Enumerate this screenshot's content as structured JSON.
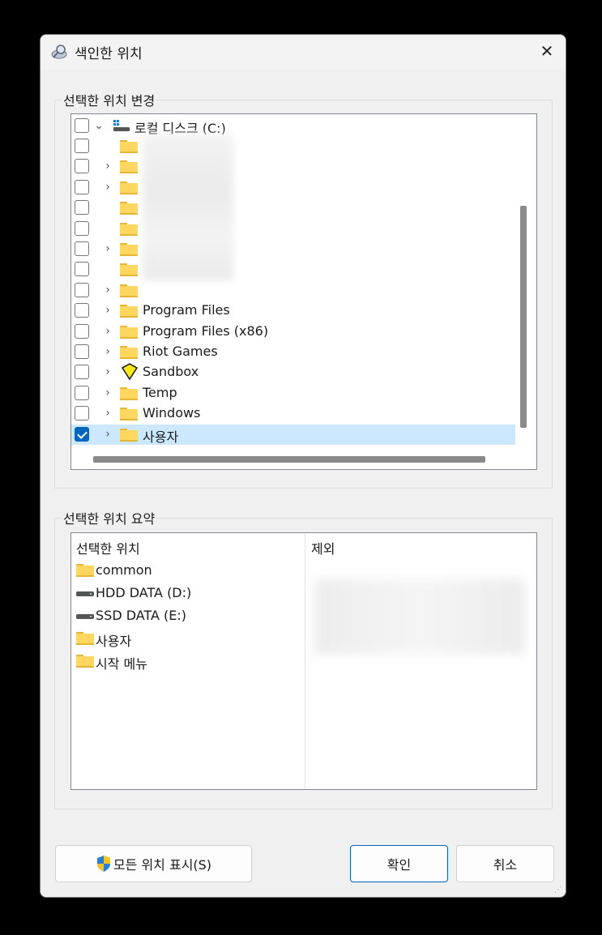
{
  "window": {
    "title": "색인한 위치",
    "close_glyph": "✕",
    "title_icon": "indexing-icon"
  },
  "change_group": {
    "legend": "선택한 위치 변경",
    "root": {
      "label": "로컬 디스크 (C:)",
      "checked": false,
      "expanded": true,
      "icon": "drive-icon"
    },
    "items": [
      {
        "label": "",
        "checked": false,
        "expandable": false,
        "blurred": true
      },
      {
        "label": "",
        "checked": false,
        "expandable": true,
        "blurred": true
      },
      {
        "label": "",
        "checked": false,
        "expandable": true,
        "blurred": true
      },
      {
        "label": "",
        "checked": false,
        "expandable": false,
        "blurred": true
      },
      {
        "label": "",
        "checked": false,
        "expandable": false,
        "blurred": true
      },
      {
        "label": "",
        "checked": false,
        "expandable": true,
        "blurred": true
      },
      {
        "label": "",
        "checked": false,
        "expandable": false,
        "blurred": true
      },
      {
        "label": "",
        "checked": false,
        "expandable": true,
        "blurred": true
      },
      {
        "label": "Program Files",
        "checked": false,
        "expandable": true
      },
      {
        "label": "Program Files (x86)",
        "checked": false,
        "expandable": true
      },
      {
        "label": "Riot Games",
        "checked": false,
        "expandable": true
      },
      {
        "label": "Sandbox",
        "checked": false,
        "expandable": true,
        "icon": "sandbox-icon"
      },
      {
        "label": "Temp",
        "checked": false,
        "expandable": true
      },
      {
        "label": "Windows",
        "checked": false,
        "expandable": true
      },
      {
        "label": "사용자",
        "checked": true,
        "expandable": true,
        "selected": true
      }
    ]
  },
  "summary_group": {
    "legend": "선택한 위치 요약",
    "col_included": "선택한 위치",
    "col_excluded": "제외",
    "included": [
      {
        "label": "common",
        "icon": "folder-icon"
      },
      {
        "label": "HDD DATA (D:)",
        "icon": "hdd-icon"
      },
      {
        "label": "SSD DATA (E:)",
        "icon": "hdd-icon"
      },
      {
        "label": "사용자",
        "icon": "folder-icon"
      },
      {
        "label": "시작 메뉴",
        "icon": "folder-icon"
      }
    ]
  },
  "buttons": {
    "show_all": "모든 위치 표시(S)",
    "ok": "확인",
    "cancel": "취소"
  },
  "colors": {
    "accent": "#0067c0",
    "selection": "#cce8ff",
    "folder": "#ffd75e"
  }
}
